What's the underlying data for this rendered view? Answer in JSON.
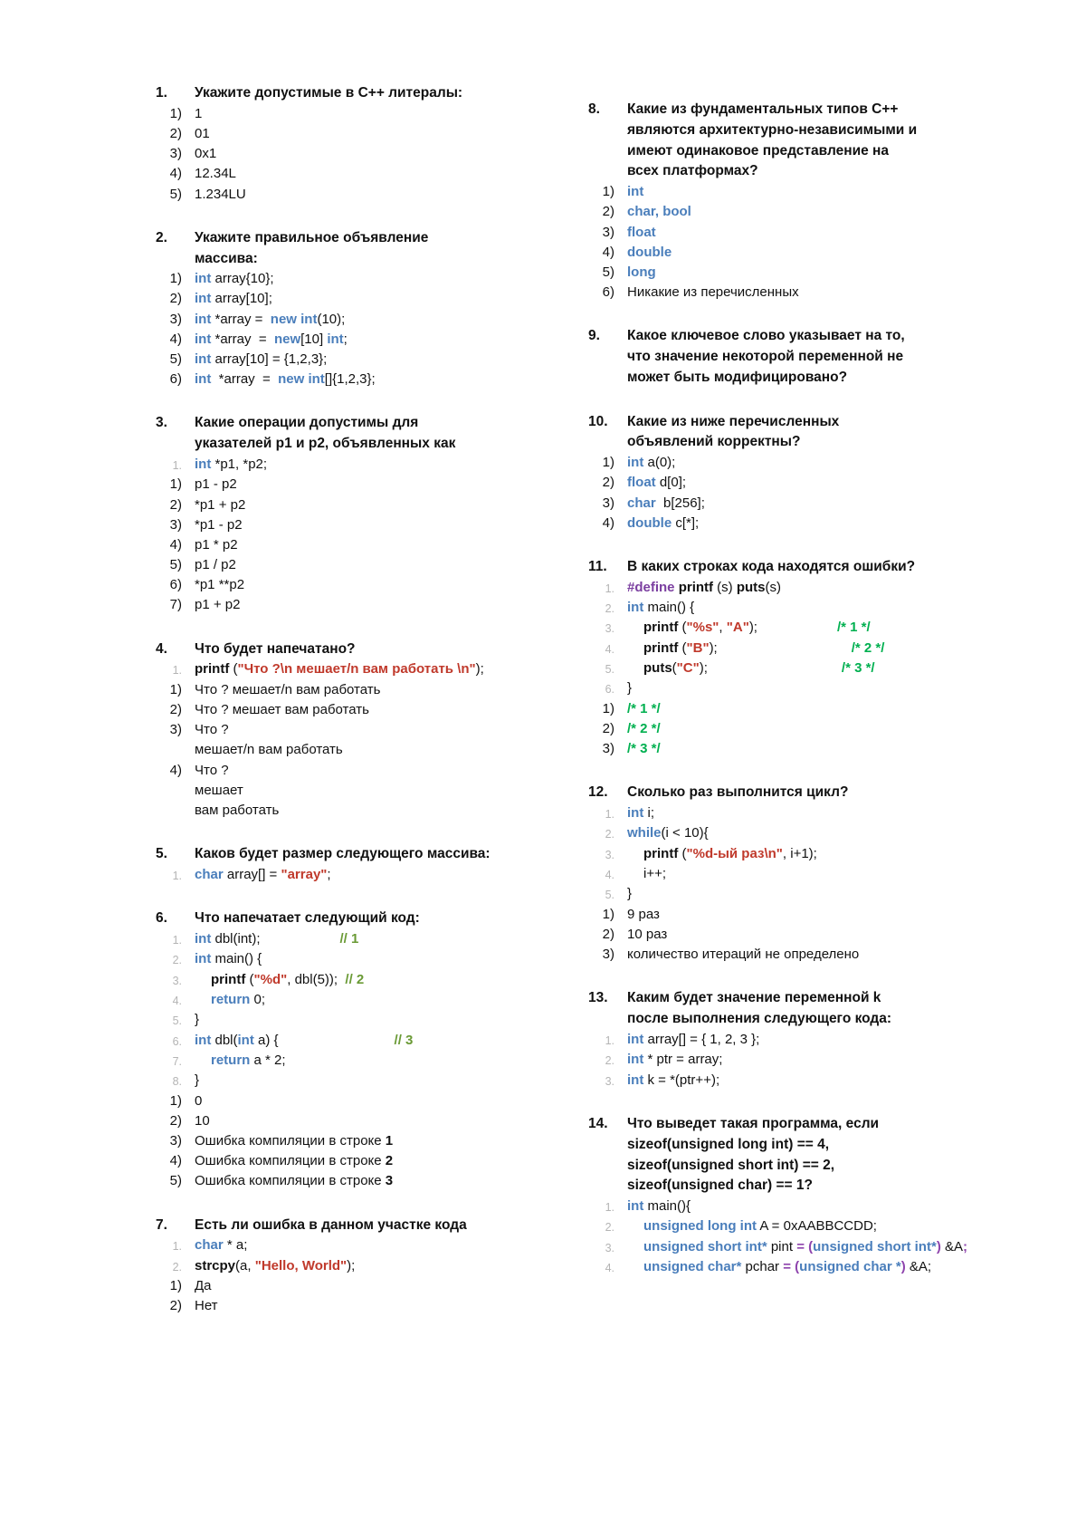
{
  "document": {
    "language": "ru",
    "title": "Тест по C++",
    "colors": {
      "keyword": "#4a7ebb",
      "string": "#c0392b",
      "comment_line": "#6a9a35",
      "comment_block": "#00b050",
      "preprocessor": "#7b3fa0",
      "operator_cast": "#8e44ad",
      "code_line_number": "#b4b4b4",
      "text": "#111111",
      "background": "#ffffff"
    }
  },
  "left_column": [
    {
      "number": "1.",
      "title": "Укажите допустимые в C++ литералы:",
      "title_lines": [
        "Укажите допустимые в C++ литералы:"
      ],
      "options": [
        {
          "marker": "1)",
          "text": "1"
        },
        {
          "marker": "2)",
          "text": "01"
        },
        {
          "marker": "3)",
          "text": "0x1"
        },
        {
          "marker": "4)",
          "text": "12.34L"
        },
        {
          "marker": "5)",
          "text": "1.234LU"
        }
      ]
    },
    {
      "number": "2.",
      "title": "Укажите правильное объявление массива:",
      "title_lines": [
        "Укажите правильное объявление",
        "массива:"
      ],
      "options": [
        {
          "marker": "1)",
          "text": "int array{10};"
        },
        {
          "marker": "2)",
          "text": "int array[10];"
        },
        {
          "marker": "3)",
          "text": "int *array =  new int(10);"
        },
        {
          "marker": "4)",
          "text": "int *array  =  new[10] int;"
        },
        {
          "marker": "5)",
          "text": "int array[10] = {1,2,3};"
        },
        {
          "marker": "6)",
          "text": "int  *array  =  new int[]{1,2,3};"
        }
      ]
    },
    {
      "number": "3.",
      "title": "Какие операции допустимы для указателей p1 и p2, объявленных как",
      "title_lines": [
        "Какие операции допустимы для",
        "указателей p1 и p2, объявленных как"
      ],
      "code": [
        {
          "n": "1.",
          "text": "int *p1, *p2;"
        }
      ],
      "options": [
        {
          "marker": "1)",
          "text": "p1 - p2"
        },
        {
          "marker": "2)",
          "text": "*p1 + p2"
        },
        {
          "marker": "3)",
          "text": "*p1 - p2"
        },
        {
          "marker": "4)",
          "text": "p1 * p2"
        },
        {
          "marker": "5)",
          "text": "p1 / p2"
        },
        {
          "marker": "6)",
          "text": "*p1 **p2"
        },
        {
          "marker": "7)",
          "text": "p1 + p2"
        }
      ]
    },
    {
      "number": "4.",
      "title": "Что будет напечатано?",
      "title_lines": [
        "Что будет напечатано?"
      ],
      "code": [
        {
          "n": "1.",
          "text": "printf (\"Что ?\\n мешает/n вам работать \\n\");"
        }
      ],
      "options": [
        {
          "marker": "1)",
          "text": "Что ? мешает/n вам работать"
        },
        {
          "marker": "2)",
          "text": "Что ? мешает вам работать"
        },
        {
          "marker": "3)",
          "text": "Что ?",
          "cont": [
            "мешает/n вам работать"
          ]
        },
        {
          "marker": "4)",
          "text": "Что ?",
          "cont": [
            "мешает",
            "вам работать"
          ]
        }
      ]
    },
    {
      "number": "5.",
      "title": "Каков будет размер следующего массива:",
      "title_lines": [
        "Каков будет размер следующего массива:"
      ],
      "code": [
        {
          "n": "1.",
          "text": "char array[] = \"array\";"
        }
      ],
      "options": []
    },
    {
      "number": "6.",
      "title": "Что напечатает следующий код:",
      "title_lines": [
        "Что напечатает следующий код:"
      ],
      "code": [
        {
          "n": "1.",
          "text": "int dbl(int);              // 1"
        },
        {
          "n": "2.",
          "text": "int main() {"
        },
        {
          "n": "3.",
          "text": "    printf (\"%d\", dbl(5));  // 2"
        },
        {
          "n": "4.",
          "text": "    return 0;"
        },
        {
          "n": "5.",
          "text": "}"
        },
        {
          "n": "6.",
          "text": "int dbl(int a) {          // 3"
        },
        {
          "n": "7.",
          "text": "    return a * 2;"
        },
        {
          "n": "8.",
          "text": "}"
        }
      ],
      "options": [
        {
          "marker": "1)",
          "text": "0"
        },
        {
          "marker": "2)",
          "text": "10"
        },
        {
          "marker": "3)",
          "text": "Ошибка компиляции в строке 1"
        },
        {
          "marker": "4)",
          "text": "Ошибка компиляции в строке 2"
        },
        {
          "marker": "5)",
          "text": "Ошибка компиляции в строке 3"
        }
      ]
    },
    {
      "number": "7.",
      "title": "Есть ли ошибка в данном участке кода",
      "title_lines": [
        "Есть ли ошибка в данном участке кода"
      ],
      "code": [
        {
          "n": "1.",
          "text": "char * a;"
        },
        {
          "n": "2.",
          "text": "strcpy(a, \"Hello, World\");"
        }
      ],
      "options": [
        {
          "marker": "1)",
          "text": "Да"
        },
        {
          "marker": "2)",
          "text": "Нет"
        }
      ]
    }
  ],
  "right_column": [
    {
      "number": "8.",
      "title": "Какие из фундаментальных типов C++ являются архитектурно-независимыми и имеют одинаковое представление на всех платформах?",
      "title_lines": [
        "Какие из фундаментальных типов C++",
        "являются архитектурно-независимыми и",
        "имеют одинаковое представление на",
        "всех платформах?"
      ],
      "options": [
        {
          "marker": "1)",
          "text": "int"
        },
        {
          "marker": "2)",
          "text": "char, bool"
        },
        {
          "marker": "3)",
          "text": "float"
        },
        {
          "marker": "4)",
          "text": "double"
        },
        {
          "marker": "5)",
          "text": "long"
        },
        {
          "marker": "6)",
          "text": "Никакие из перечисленных"
        }
      ]
    },
    {
      "number": "9.",
      "title": "Какое ключевое слово указывает на то, что значение некоторой переменной не может быть модифицировано?",
      "title_lines": [
        "Какое ключевое слово указывает на то,",
        "что значение некоторой переменной не",
        "может быть модифицировано?"
      ],
      "options": []
    },
    {
      "number": "10.",
      "title": "Какие из ниже перечисленных объявлений корректны?",
      "title_lines": [
        "Какие из ниже перечисленных",
        "объявлений корректны?"
      ],
      "options": [
        {
          "marker": "1)",
          "text": "int a(0);"
        },
        {
          "marker": "2)",
          "text": "float d[0];"
        },
        {
          "marker": "3)",
          "text": "char  b[256];"
        },
        {
          "marker": "4)",
          "text": "double c[*];"
        }
      ]
    },
    {
      "number": "11.",
      "title": "В каких строках кода находятся ошибки?",
      "title_lines": [
        "В каких строках кода находятся ошибки?"
      ],
      "code": [
        {
          "n": "1.",
          "text": "#define printf (s) puts(s)"
        },
        {
          "n": "2.",
          "text": "int main() {"
        },
        {
          "n": "3.",
          "text": "   printf (\"%s\", \"A\");        /* 1 */"
        },
        {
          "n": "4.",
          "text": "   printf (\"B\");              /* 2 */"
        },
        {
          "n": "5.",
          "text": "   puts(\"C\");                 /* 3 */"
        },
        {
          "n": "6.",
          "text": "}"
        }
      ],
      "options": [
        {
          "marker": "1)",
          "text": "/* 1 */"
        },
        {
          "marker": "2)",
          "text": "/* 2 */"
        },
        {
          "marker": "3)",
          "text": "/* 3 */"
        }
      ]
    },
    {
      "number": "12.",
      "title": "Сколько раз выполнится цикл?",
      "title_lines": [
        "Сколько раз выполнится цикл?"
      ],
      "code": [
        {
          "n": "1.",
          "text": "int i;"
        },
        {
          "n": "2.",
          "text": "while(i < 10){"
        },
        {
          "n": "3.",
          "text": "   printf (\"%d-ый раз\\n\", i+1);"
        },
        {
          "n": "4.",
          "text": "   i++;"
        },
        {
          "n": "5.",
          "text": "}"
        }
      ],
      "options": [
        {
          "marker": "1)",
          "text": "9 раз"
        },
        {
          "marker": "2)",
          "text": "10 раз"
        },
        {
          "marker": "3)",
          "text": "количество итераций не определено"
        }
      ]
    },
    {
      "number": "13.",
      "title": "Каким будет значение переменной k после выполнения следующего кода:",
      "title_lines": [
        "Каким будет значение переменной k",
        "после выполнения следующего кода:"
      ],
      "code": [
        {
          "n": "1.",
          "text": "int array[] = { 1, 2, 3 };"
        },
        {
          "n": "2.",
          "text": "int * ptr = array;"
        },
        {
          "n": "3.",
          "text": "int k = *(ptr++);"
        }
      ],
      "options": []
    },
    {
      "number": "14.",
      "title": "Что выведет такая программа, если sizeof(unsigned long int) == 4, sizeof(unsigned short int) == 2, sizeof(unsigned char) == 1?",
      "title_lines": [
        "Что выведет такая программа, если",
        "sizeof(unsigned long int) == 4,",
        "sizeof(unsigned short int) == 2,",
        "sizeof(unsigned char) == 1?"
      ],
      "code": [
        {
          "n": "1.",
          "text": "int main(){"
        },
        {
          "n": "2.",
          "text": "   unsigned long int A = 0xAABBCCDD;"
        },
        {
          "n": "3.",
          "text": "   unsigned short int* pint = (unsigned short int*) &A;"
        },
        {
          "n": "4.",
          "text": "   unsigned char* pchar = (unsigned char *) &A;"
        }
      ],
      "options": []
    }
  ]
}
